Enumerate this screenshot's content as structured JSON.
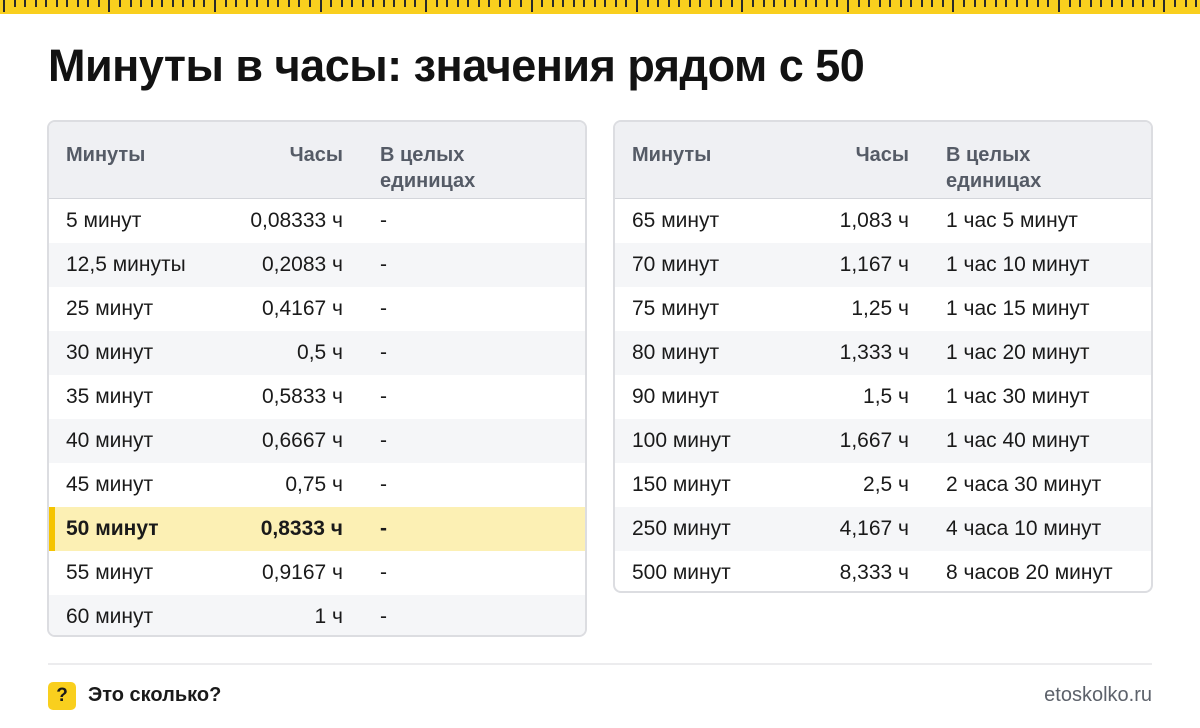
{
  "title": "Минуты в часы: значения рядом с 50",
  "accent_color": "#f9cf1e",
  "highlight_color": "#fcf0b4",
  "columns": {
    "minutes": "Минуты",
    "hours": "Часы",
    "whole_units": "В целых единицах"
  },
  "left_table": {
    "rows": [
      {
        "minutes": "5 минут",
        "hours": "0,08333 ч",
        "whole": "-"
      },
      {
        "minutes": "12,5 минуты",
        "hours": "0,2083 ч",
        "whole": "-"
      },
      {
        "minutes": "25 минут",
        "hours": "0,4167 ч",
        "whole": "-"
      },
      {
        "minutes": "30 минут",
        "hours": "0,5 ч",
        "whole": "-"
      },
      {
        "minutes": "35 минут",
        "hours": "0,5833 ч",
        "whole": "-"
      },
      {
        "minutes": "40 минут",
        "hours": "0,6667 ч",
        "whole": "-"
      },
      {
        "minutes": "45 минут",
        "hours": "0,75 ч",
        "whole": "-"
      },
      {
        "minutes": "50 минут",
        "hours": "0,8333 ч",
        "whole": "-"
      },
      {
        "minutes": "55 минут",
        "hours": "0,9167 ч",
        "whole": "-"
      },
      {
        "minutes": "60 минут",
        "hours": "1 ч",
        "whole": "-"
      }
    ]
  },
  "right_table": {
    "rows": [
      {
        "minutes": "65 минут",
        "hours": "1,083 ч",
        "whole": "1 час 5 минут"
      },
      {
        "minutes": "70 минут",
        "hours": "1,167 ч",
        "whole": "1 час 10 минут"
      },
      {
        "minutes": "75 минут",
        "hours": "1,25 ч",
        "whole": "1 час 15 минут"
      },
      {
        "minutes": "80 минут",
        "hours": "1,333 ч",
        "whole": "1 час 20 минут"
      },
      {
        "minutes": "90 минут",
        "hours": "1,5 ч",
        "whole": "1 час 30 минут"
      },
      {
        "minutes": "100 минут",
        "hours": "1,667 ч",
        "whole": "1 час 40 минут"
      },
      {
        "minutes": "150 минут",
        "hours": "2,5 ч",
        "whole": "2 часа 30 минут"
      },
      {
        "minutes": "250 минут",
        "hours": "4,167 ч",
        "whole": "4 часа 10 минут"
      },
      {
        "minutes": "500 минут",
        "hours": "8,333 ч",
        "whole": "8 часов 20 минут"
      }
    ]
  },
  "footer": {
    "badge": "?",
    "brand": "Это сколько?",
    "site": "etoskolko.ru"
  }
}
